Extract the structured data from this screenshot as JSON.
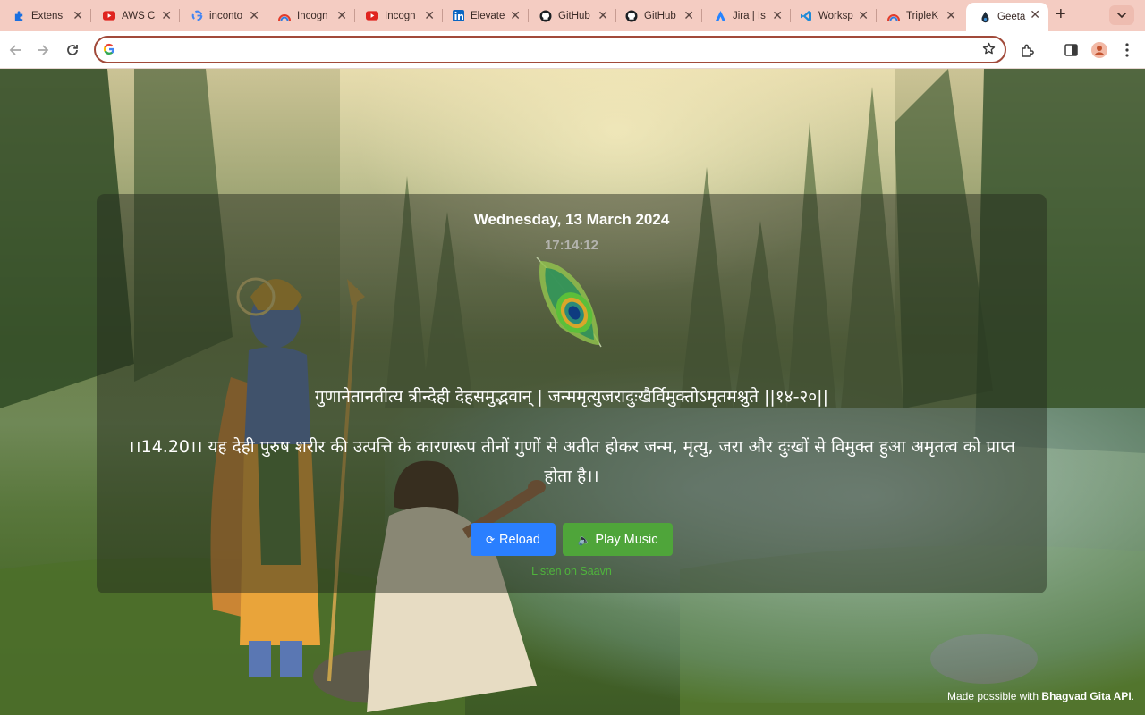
{
  "tabs": [
    {
      "title": "Extens",
      "icon": "puzzle-icon",
      "active": false
    },
    {
      "title": "AWS C",
      "icon": "youtube-icon",
      "active": false
    },
    {
      "title": "inconto",
      "icon": "google-icon",
      "active": false
    },
    {
      "title": "Incogn",
      "icon": "rainbow-icon",
      "active": false
    },
    {
      "title": "Incogn",
      "icon": "youtube-icon",
      "active": false
    },
    {
      "title": "Elevate",
      "icon": "linkedin-icon",
      "active": false
    },
    {
      "title": "GitHub",
      "icon": "github-icon",
      "active": false
    },
    {
      "title": "GitHub",
      "icon": "github-icon",
      "active": false
    },
    {
      "title": "Jira | Is",
      "icon": "jira-icon",
      "active": false
    },
    {
      "title": "Worksp",
      "icon": "vscode-icon",
      "active": false
    },
    {
      "title": "TripleK",
      "icon": "rainbow-icon",
      "active": false
    },
    {
      "title": "Geeta",
      "icon": "drop-icon",
      "active": true
    }
  ],
  "address_bar": {
    "value": "",
    "placeholder": ""
  },
  "page": {
    "date": "Wednesday, 13 March 2024",
    "time": "17:14:12",
    "verse": "गुणानेतानतीत्य त्रीन्देही देहसमुद्भवान् | जन्ममृत्युजरादुःखैर्विमुक्तोऽमृतमश्नुते ||१४-२०||",
    "translation": "।।14.20।। यह देही पुरुष शरीर की उत्पत्ति के कारणरूप तीनों गुणों से अतीत होकर जन्म, मृत्यु, जरा और दुःखों से विमुक्त हुआ अमृतत्व को प्राप्त होता है।।",
    "reload_icon": "⟳",
    "reload_label": "Reload",
    "music_icon": "🔈",
    "music_label": "Play Music",
    "saavn_link": "Listen on Saavn",
    "footer_prefix": "Made possible with ",
    "footer_api": "Bhagvad Gita API",
    "footer_suffix": "."
  },
  "colors": {
    "tabstrip": "#f4ccc2",
    "omnibox_border": "#a14a3a",
    "reload_button": "#2a7fff",
    "music_button": "#4fa53a",
    "saavn_link": "#4fb53c"
  }
}
